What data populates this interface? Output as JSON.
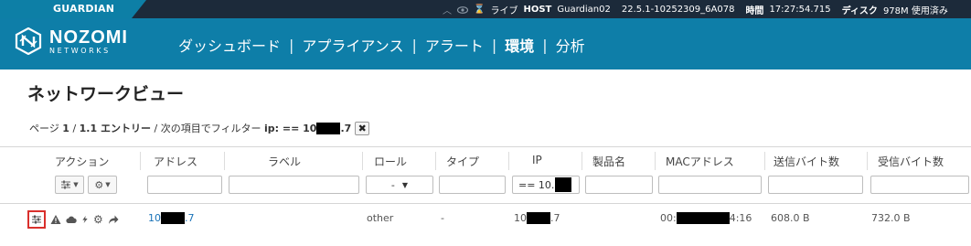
{
  "topbar": {
    "product": "GUARDIAN",
    "live_label": "ライブ",
    "host_label": "HOST",
    "host_value": "Guardian02",
    "version": "22.5.1-10252309_6A078",
    "time_label": "時間",
    "time_value": "17:27:54.715",
    "disk_label": "ディスク",
    "disk_value": "978M 使用済み"
  },
  "brand": {
    "line1": "NOZOMI",
    "line2": "NETWORKS"
  },
  "nav": {
    "items": [
      {
        "label": "ダッシュボード"
      },
      {
        "label": "アプライアンス"
      },
      {
        "label": "アラート"
      },
      {
        "label": "環境",
        "active": true
      },
      {
        "label": "分析"
      }
    ],
    "separator": "|"
  },
  "page": {
    "title": "ネットワークビュー"
  },
  "filter": {
    "prefix": "ページ",
    "page": "1",
    "slash1": "/",
    "entries": "1.1 エントリー",
    "slash2": "/",
    "filter_text": "次の項目でフィルター",
    "expr_label": "ip: == 10",
    "expr_suffix": ".7",
    "clear_glyph": "✖"
  },
  "table": {
    "columns": [
      "アクション",
      "アドレス",
      "ラベル",
      "ロール",
      "タイプ",
      "IP",
      "製品名",
      "MACアドレス",
      "送信バイト数",
      "受信バイト数"
    ],
    "role_select": "-",
    "ip_filter_value": "== 10.",
    "row": {
      "address_prefix": "10",
      "address_suffix": ".7",
      "role": "other",
      "type": "-",
      "ip_prefix": "10",
      "ip_suffix": ".7",
      "mac_prefix": "00:",
      "mac_suffix": "4:16",
      "sent": "608.0 B",
      "received": "732.0 B"
    }
  }
}
